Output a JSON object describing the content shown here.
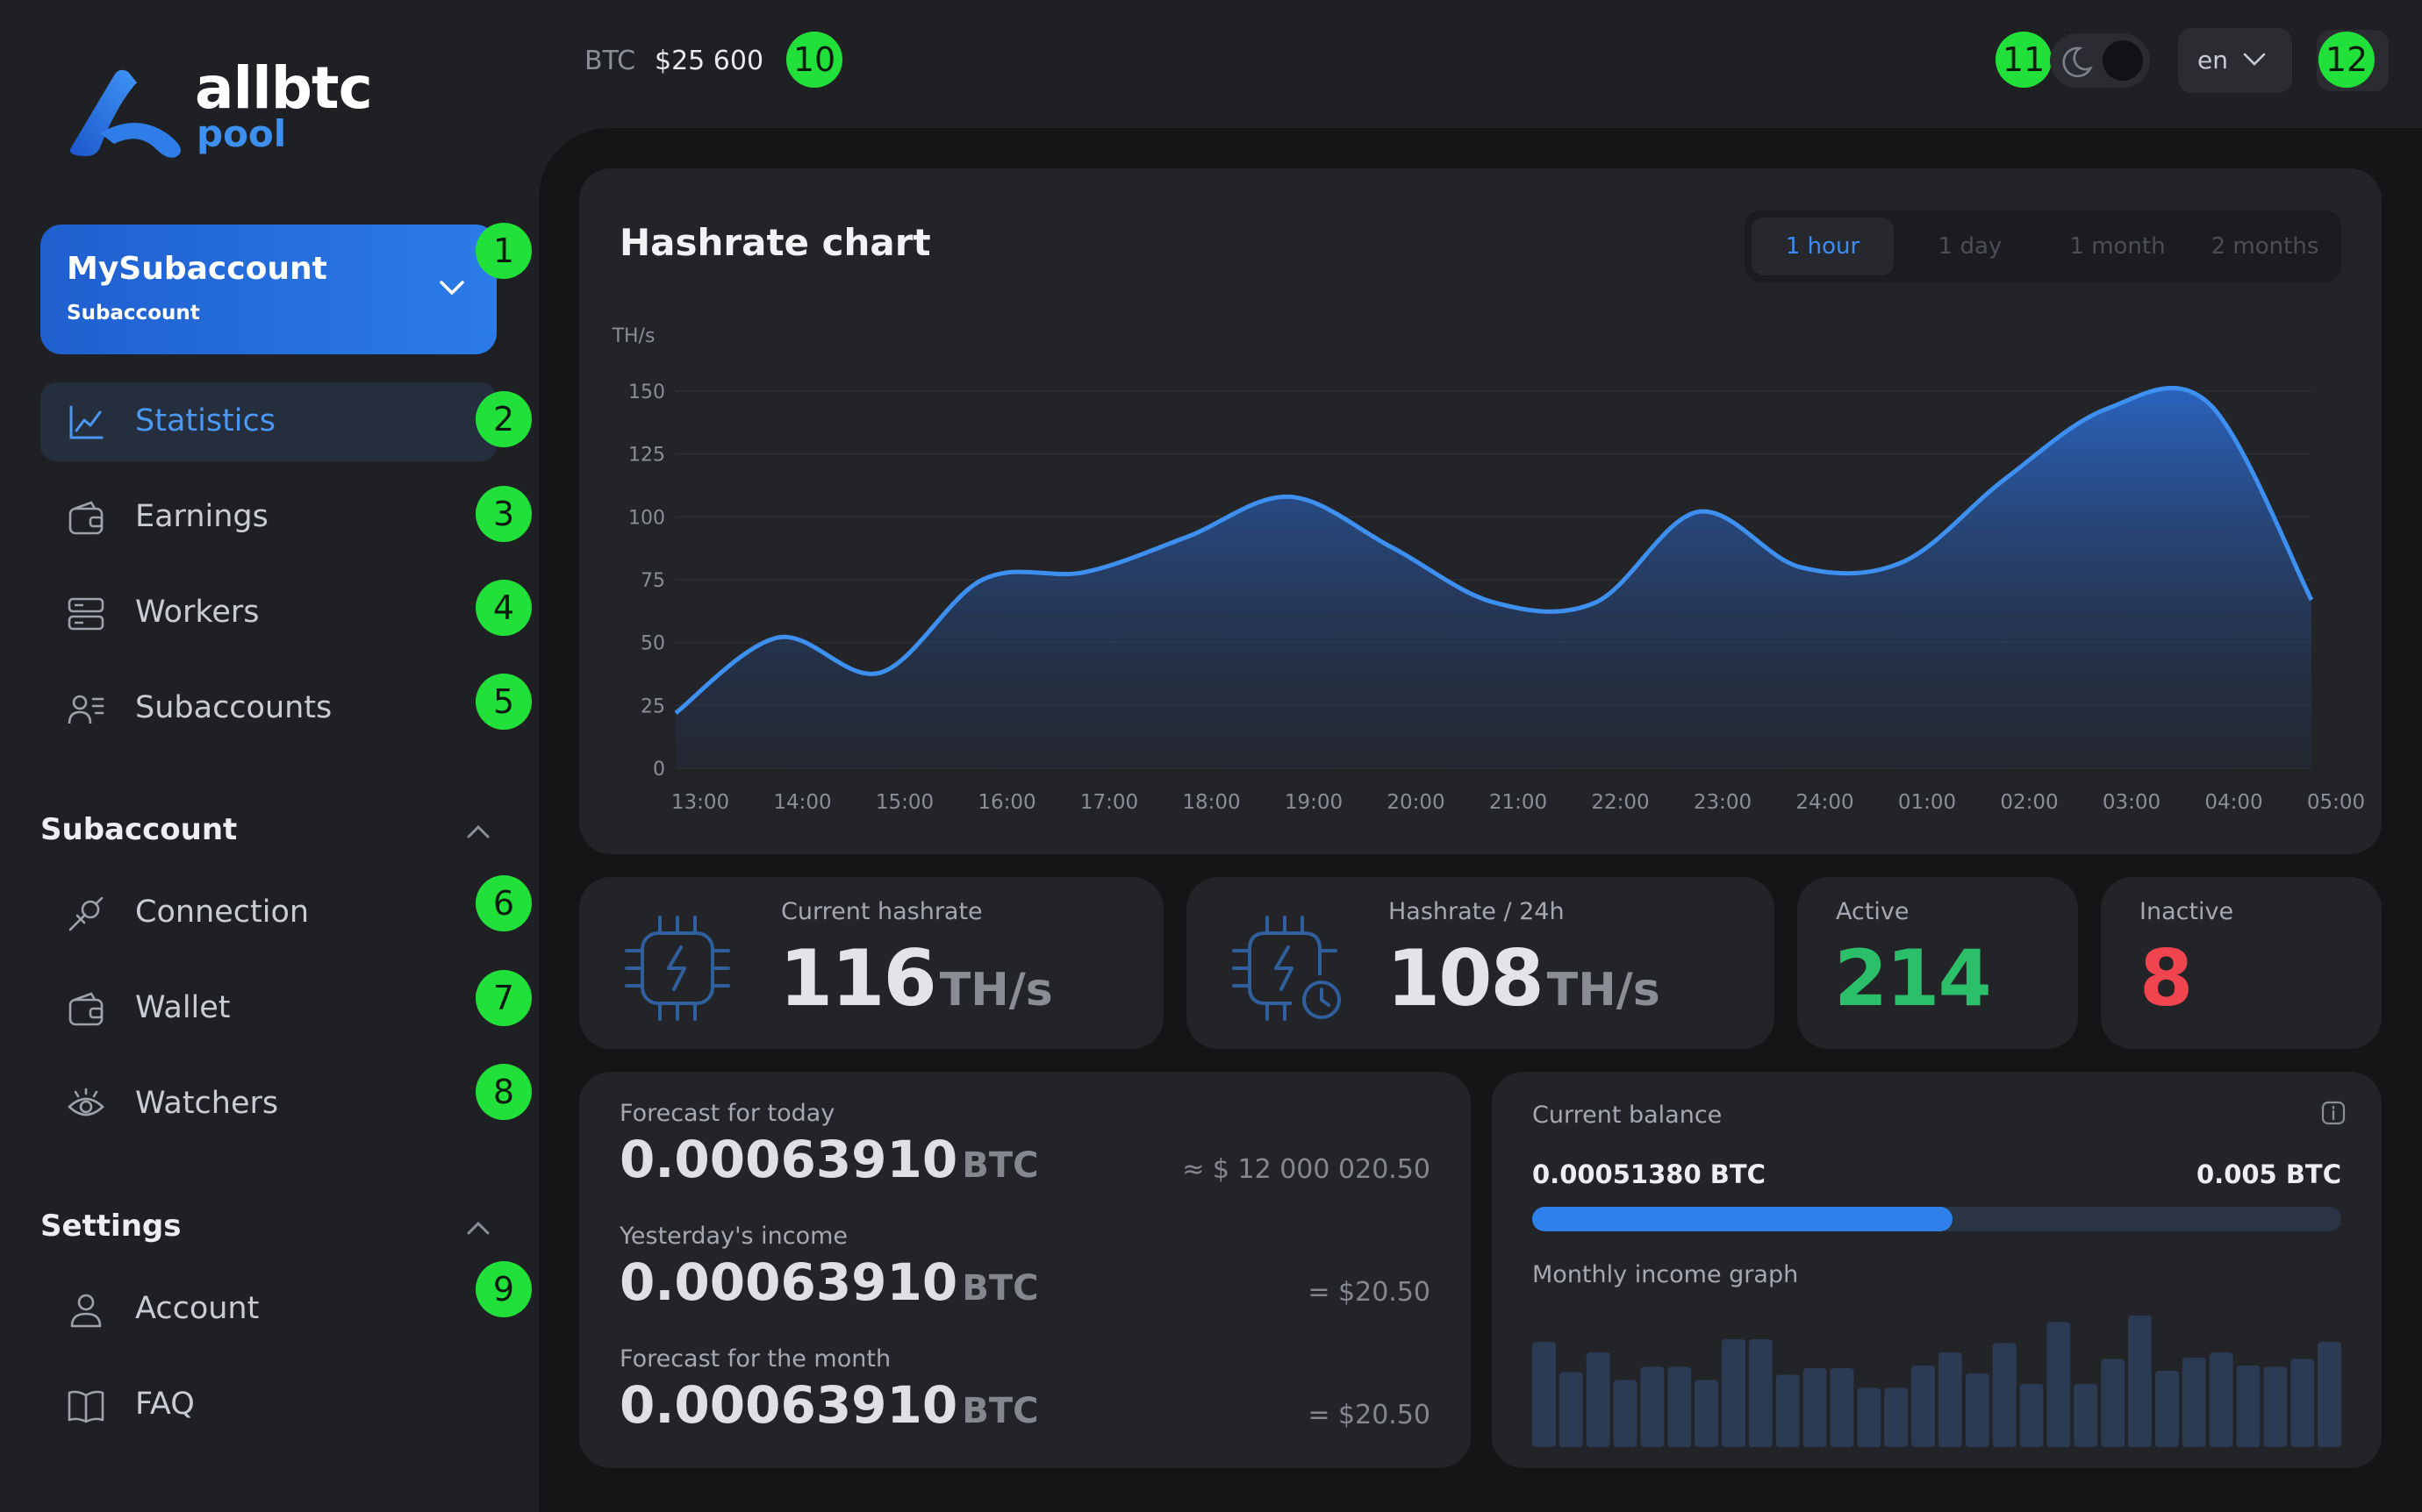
{
  "brand": {
    "name": "allbtc",
    "sub": "pool"
  },
  "topbar": {
    "ticker": "BTC",
    "price": "$25 600",
    "lang": "en"
  },
  "account": {
    "name": "MySubaccount",
    "type": "Subaccount"
  },
  "nav": [
    {
      "label": "Statistics",
      "icon": "chart-line-icon",
      "active": true
    },
    {
      "label": "Earnings",
      "icon": "wallet-icon"
    },
    {
      "label": "Workers",
      "icon": "server-icon"
    },
    {
      "label": "Subaccounts",
      "icon": "users-icon"
    }
  ],
  "subaccount_section": {
    "title": "Subaccount",
    "items": [
      {
        "label": "Connection",
        "icon": "plug-icon"
      },
      {
        "label": "Wallet",
        "icon": "wallet-icon"
      },
      {
        "label": "Watchers",
        "icon": "eye-icon"
      }
    ]
  },
  "settings_section": {
    "title": "Settings",
    "items": [
      {
        "label": "Account",
        "icon": "user-icon"
      },
      {
        "label": "FAQ",
        "icon": "book-icon"
      }
    ]
  },
  "badges": [
    "1",
    "2",
    "3",
    "4",
    "5",
    "6",
    "7",
    "8",
    "9",
    "10",
    "11",
    "12"
  ],
  "hashrate_chart": {
    "title": "Hashrate chart",
    "tabs": [
      "1 hour",
      "1 day",
      "1 month",
      "2 months"
    ],
    "active_tab": 0
  },
  "chart_data": {
    "type": "area",
    "title": "Hashrate chart",
    "ylabel": "TH/s",
    "ylim": [
      0,
      150
    ],
    "yticks": [
      0,
      25,
      50,
      75,
      100,
      125,
      150
    ],
    "categories": [
      "13:00",
      "14:00",
      "15:00",
      "16:00",
      "17:00",
      "18:00",
      "19:00",
      "20:00",
      "21:00",
      "22:00",
      "23:00",
      "24:00",
      "01:00",
      "02:00",
      "03:00",
      "04:00",
      "05:00"
    ],
    "values": [
      22,
      52,
      38,
      75,
      78,
      92,
      108,
      88,
      66,
      66,
      102,
      80,
      82,
      115,
      143,
      145,
      67
    ],
    "grid": true,
    "color": "#3d8ff0"
  },
  "stats": {
    "current": {
      "label": "Current hashrate",
      "value": "116",
      "unit": "TH/s"
    },
    "day": {
      "label": "Hashrate / 24h",
      "value": "108",
      "unit": "TH/s"
    },
    "active": {
      "label": "Active",
      "value": "214",
      "color": "#2cbf6a"
    },
    "inactive": {
      "label": "Inactive",
      "value": "8",
      "color": "#f0454e"
    }
  },
  "forecast": [
    {
      "label": "Forecast for today",
      "value": "0.00063910",
      "unit": "BTC",
      "fiat": "≈ $ 12 000 020.50"
    },
    {
      "label": "Yesterday's income",
      "value": "0.00063910",
      "unit": "BTC",
      "fiat": "= $20.50"
    },
    {
      "label": "Forecast for the month",
      "value": "0.00063910",
      "unit": "BTC",
      "fiat": "= $20.50"
    }
  ],
  "balance": {
    "label": "Current balance",
    "current": "0.00051380 BTC",
    "threshold": "0.005 BTC",
    "progress": 0.52,
    "graph_label": "Monthly income graph",
    "monthly_bars": [
      0.8,
      0.57,
      0.72,
      0.51,
      0.61,
      0.61,
      0.51,
      0.82,
      0.82,
      0.55,
      0.6,
      0.6,
      0.45,
      0.45,
      0.62,
      0.72,
      0.56,
      0.79,
      0.48,
      0.95,
      0.48,
      0.67,
      1.0,
      0.58,
      0.68,
      0.72,
      0.62,
      0.61,
      0.67,
      0.8
    ]
  }
}
